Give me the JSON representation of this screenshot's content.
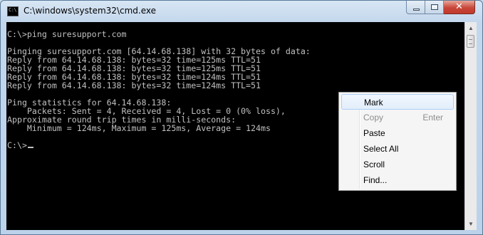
{
  "window": {
    "title": "C:\\windows\\system32\\cmd.exe",
    "icon": "cmd-icon",
    "icon_text": "C:\\"
  },
  "caption": {
    "minimize_icon": "minimize-icon",
    "maximize_icon": "maximize-icon",
    "close_icon": "close-icon",
    "close_glyph": "✕"
  },
  "console": {
    "lines": [
      "C:\\>ping suresupport.com",
      "",
      "Pinging suresupport.com [64.14.68.138] with 32 bytes of data:",
      "Reply from 64.14.68.138: bytes=32 time=125ms TTL=51",
      "Reply from 64.14.68.138: bytes=32 time=125ms TTL=51",
      "Reply from 64.14.68.138: bytes=32 time=124ms TTL=51",
      "Reply from 64.14.68.138: bytes=32 time=124ms TTL=51",
      "",
      "Ping statistics for 64.14.68.138:",
      "    Packets: Sent = 4, Received = 4, Lost = 0 (0% loss),",
      "Approximate round trip times in milli-seconds:",
      "    Minimum = 124ms, Maximum = 125ms, Average = 124ms",
      "",
      "C:\\>"
    ],
    "text_color": "#c0c0c0",
    "background": "#000000"
  },
  "scrollbar": {
    "up_arrow": "▲",
    "down_arrow": "▼"
  },
  "context_menu": {
    "items": [
      {
        "label": "Mark",
        "shortcut": "",
        "state": "highlighted"
      },
      {
        "label": "Copy",
        "shortcut": "Enter",
        "state": "disabled"
      },
      {
        "label": "Paste",
        "shortcut": "",
        "state": "normal"
      },
      {
        "label": "Select All",
        "shortcut": "",
        "state": "normal"
      },
      {
        "label": "Scroll",
        "shortcut": "",
        "state": "normal"
      },
      {
        "label": "Find...",
        "shortcut": "",
        "state": "normal"
      }
    ]
  }
}
